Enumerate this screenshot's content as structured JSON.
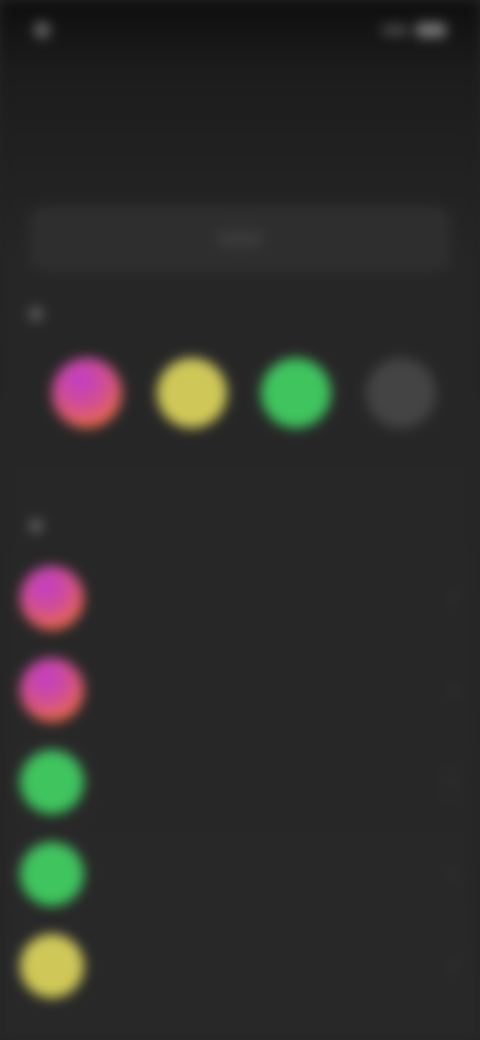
{
  "status_bar": {
    "left_text": "",
    "right_text": ""
  },
  "header": {
    "title": "",
    "subtitle": ""
  },
  "action_bar": {
    "label": ""
  },
  "sections": [
    {
      "label": ""
    },
    {
      "label": ""
    }
  ],
  "quick_contacts": [
    {
      "name": "",
      "avatar": "instagram-gradient"
    },
    {
      "name": "",
      "avatar": "yellow"
    },
    {
      "name": "",
      "avatar": "green"
    },
    {
      "name": "",
      "avatar": "gray"
    }
  ],
  "list_items": [
    {
      "name": "",
      "avatar": "instagram-gradient"
    },
    {
      "name": "",
      "avatar": "instagram-gradient"
    },
    {
      "name": "",
      "avatar": "green"
    },
    {
      "name": "",
      "avatar": "green"
    },
    {
      "name": "",
      "avatar": "yellow"
    }
  ],
  "colors": {
    "background": "#262626",
    "instagram_purple": "#c03cc8",
    "instagram_orange": "#ef6f3c",
    "yellow": "#cfc858",
    "green": "#3fc45e"
  }
}
